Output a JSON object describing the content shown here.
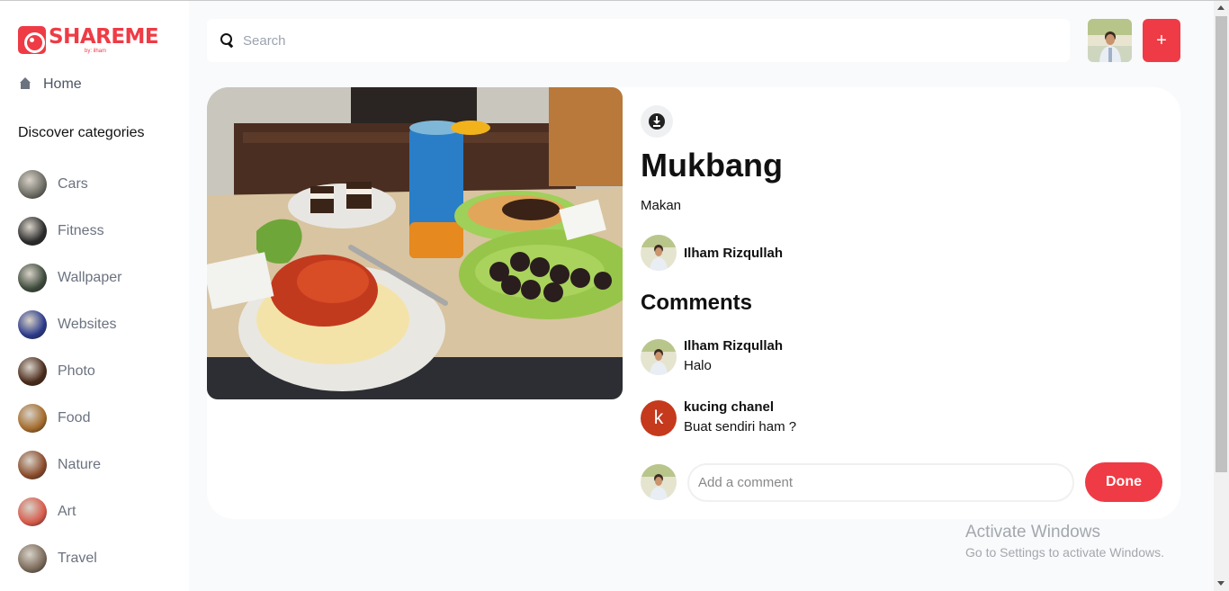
{
  "app": {
    "brand": "SHAREME",
    "brand_sub": "by: ilham",
    "accent_color": "#ef3b45"
  },
  "sidebar": {
    "home_label": "Home",
    "discover_heading": "Discover categories",
    "categories": [
      {
        "label": "Cars",
        "thumb": "#6b6b63"
      },
      {
        "label": "Fitness",
        "thumb": "#2b2b2b"
      },
      {
        "label": "Wallpaper",
        "thumb": "#3d4a3c"
      },
      {
        "label": "Websites",
        "thumb": "#2a3a8a"
      },
      {
        "label": "Photo",
        "thumb": "#4a2a1a"
      },
      {
        "label": "Food",
        "thumb": "#a36a2a"
      },
      {
        "label": "Nature",
        "thumb": "#8a4a2a"
      },
      {
        "label": "Art",
        "thumb": "#d65a4a"
      },
      {
        "label": "Travel",
        "thumb": "#7a6a5a"
      }
    ]
  },
  "topbar": {
    "search_placeholder": "Search",
    "add_button_label": "+"
  },
  "pin": {
    "title": "Mukbang",
    "description": "Makan",
    "author": "Ilham Rizqullah"
  },
  "comments": {
    "heading": "Comments",
    "items": [
      {
        "name": "Ilham Rizqullah",
        "text": "Halo",
        "avatar": "photo"
      },
      {
        "name": "kucing chanel",
        "text": "Buat sendiri ham ?",
        "avatar": "letter",
        "letter": "k"
      }
    ],
    "input_placeholder": "Add a comment",
    "done_label": "Done"
  },
  "watermark": {
    "title": "Activate Windows",
    "subtitle": "Go to Settings to activate Windows."
  }
}
